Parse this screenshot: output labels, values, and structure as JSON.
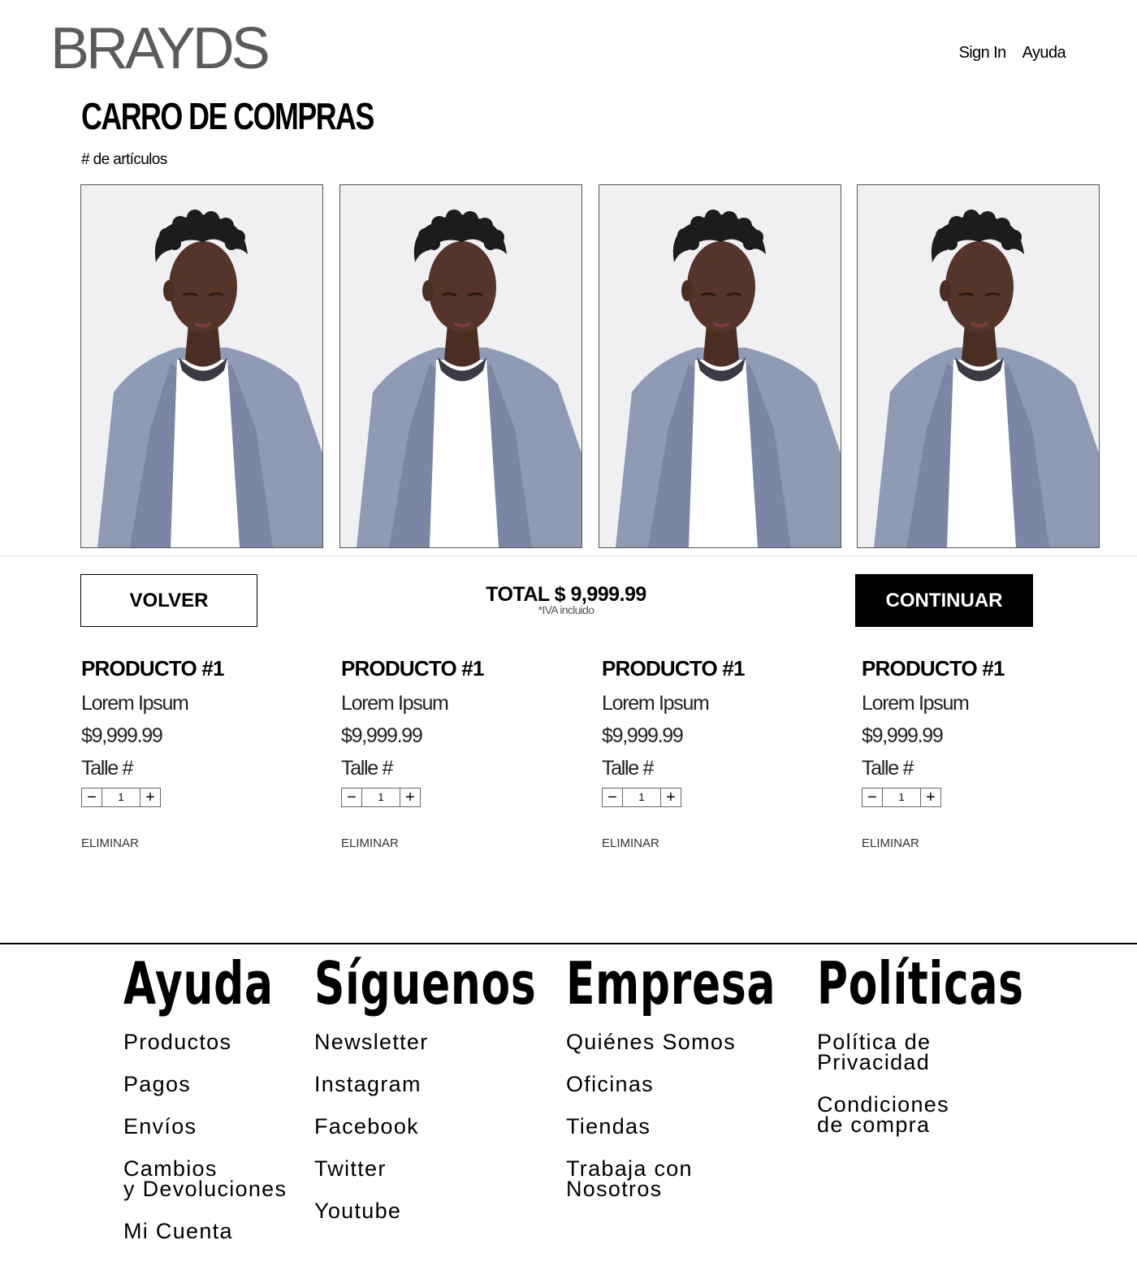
{
  "header": {
    "logo": "BRAYDS",
    "nav": [
      "Sign In",
      "Ayuda"
    ]
  },
  "cart": {
    "title": "CARRO DE COMPRAS",
    "item_count_label": "# de artículos",
    "back_label": "VOLVER",
    "continue_label": "CONTINUAR",
    "total": "TOTAL $ 9,999.99",
    "tax_note": "*IVA incluido"
  },
  "products": [
    {
      "name": "PRODUCTO #1",
      "desc": "Lorem Ipsum",
      "price": "$9,999.99",
      "size": "Talle #",
      "qty": "1",
      "remove": "ELIMINAR"
    },
    {
      "name": "PRODUCTO #1",
      "desc": "Lorem Ipsum",
      "price": "$9,999.99",
      "size": "Talle #",
      "qty": "1",
      "remove": "ELIMINAR"
    },
    {
      "name": "PRODUCTO #1",
      "desc": "Lorem Ipsum",
      "price": "$9,999.99",
      "size": "Talle #",
      "qty": "1",
      "remove": "ELIMINAR"
    },
    {
      "name": "PRODUCTO #1",
      "desc": "Lorem Ipsum",
      "price": "$9,999.99",
      "size": "Talle #",
      "qty": "1",
      "remove": "ELIMINAR"
    }
  ],
  "qty_controls": {
    "minus": "−",
    "plus": "+"
  },
  "footer": {
    "columns": [
      {
        "title": "Ayuda",
        "links": [
          "Productos",
          "Pagos",
          "Envíos",
          "Cambios\ny Devoluciones",
          "Mi Cuenta"
        ]
      },
      {
        "title": "Síguenos",
        "links": [
          "Newsletter",
          "Instagram",
          "Facebook",
          "Twitter",
          "Youtube"
        ]
      },
      {
        "title": "Empresa",
        "links": [
          "Quiénes Somos",
          "Oficinas",
          "Tiendas",
          "Trabaja con\nNosotros"
        ]
      },
      {
        "title": "Políticas",
        "links": [
          "Política de\nPrivacidad",
          "Condiciones\nde compra"
        ]
      }
    ]
  },
  "colors": {
    "logo": "#5c5a5b",
    "button_dark": "#000000",
    "photo_bg": "#ecedf0",
    "jacket": "#8f9ab5"
  }
}
